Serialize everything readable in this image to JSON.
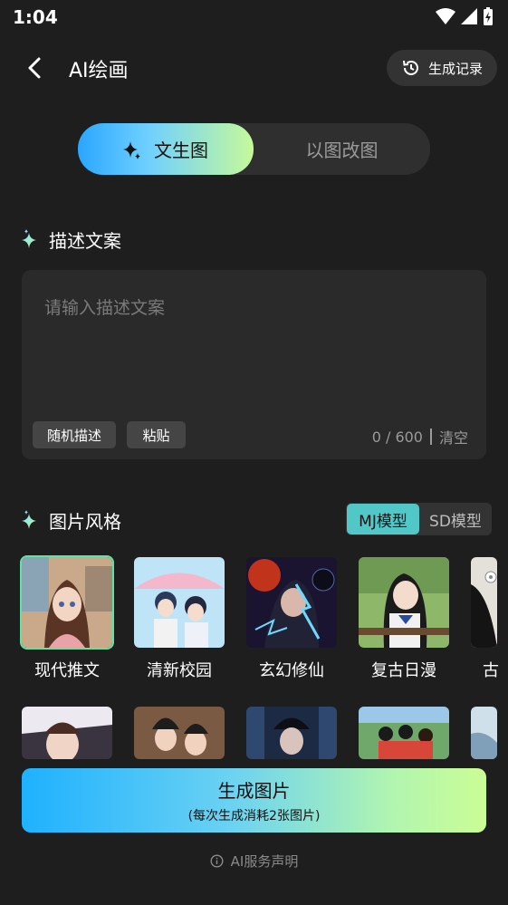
{
  "status": {
    "time": "1:04"
  },
  "header": {
    "title": "AI绘画",
    "history_label": "生成记录"
  },
  "mode_tabs": [
    {
      "label": "文生图",
      "active": true
    },
    {
      "label": "以图改图",
      "active": false
    }
  ],
  "description": {
    "heading": "描述文案",
    "placeholder": "请输入描述文案",
    "random_label": "随机描述",
    "paste_label": "粘贴",
    "counter": "0 / 600",
    "clear_label": "清空"
  },
  "style": {
    "heading": "图片风格",
    "models": [
      {
        "label": "MJ模型",
        "active": true
      },
      {
        "label": "SD模型",
        "active": false
      }
    ],
    "row1": [
      {
        "label": "现代推文",
        "selected": true
      },
      {
        "label": "清新校园",
        "selected": false
      },
      {
        "label": "玄幻修仙",
        "selected": false
      },
      {
        "label": "复古日漫",
        "selected": false
      },
      {
        "label": "古",
        "selected": false
      }
    ]
  },
  "generate": {
    "label": "生成图片",
    "sublabel": "(每次生成消耗2张图片)"
  },
  "disclaimer": "AI服务声明",
  "colors": {
    "background": "#1e1e1e",
    "accent_teal": "#52c7c8",
    "selected_border": "#5fe3a4"
  }
}
